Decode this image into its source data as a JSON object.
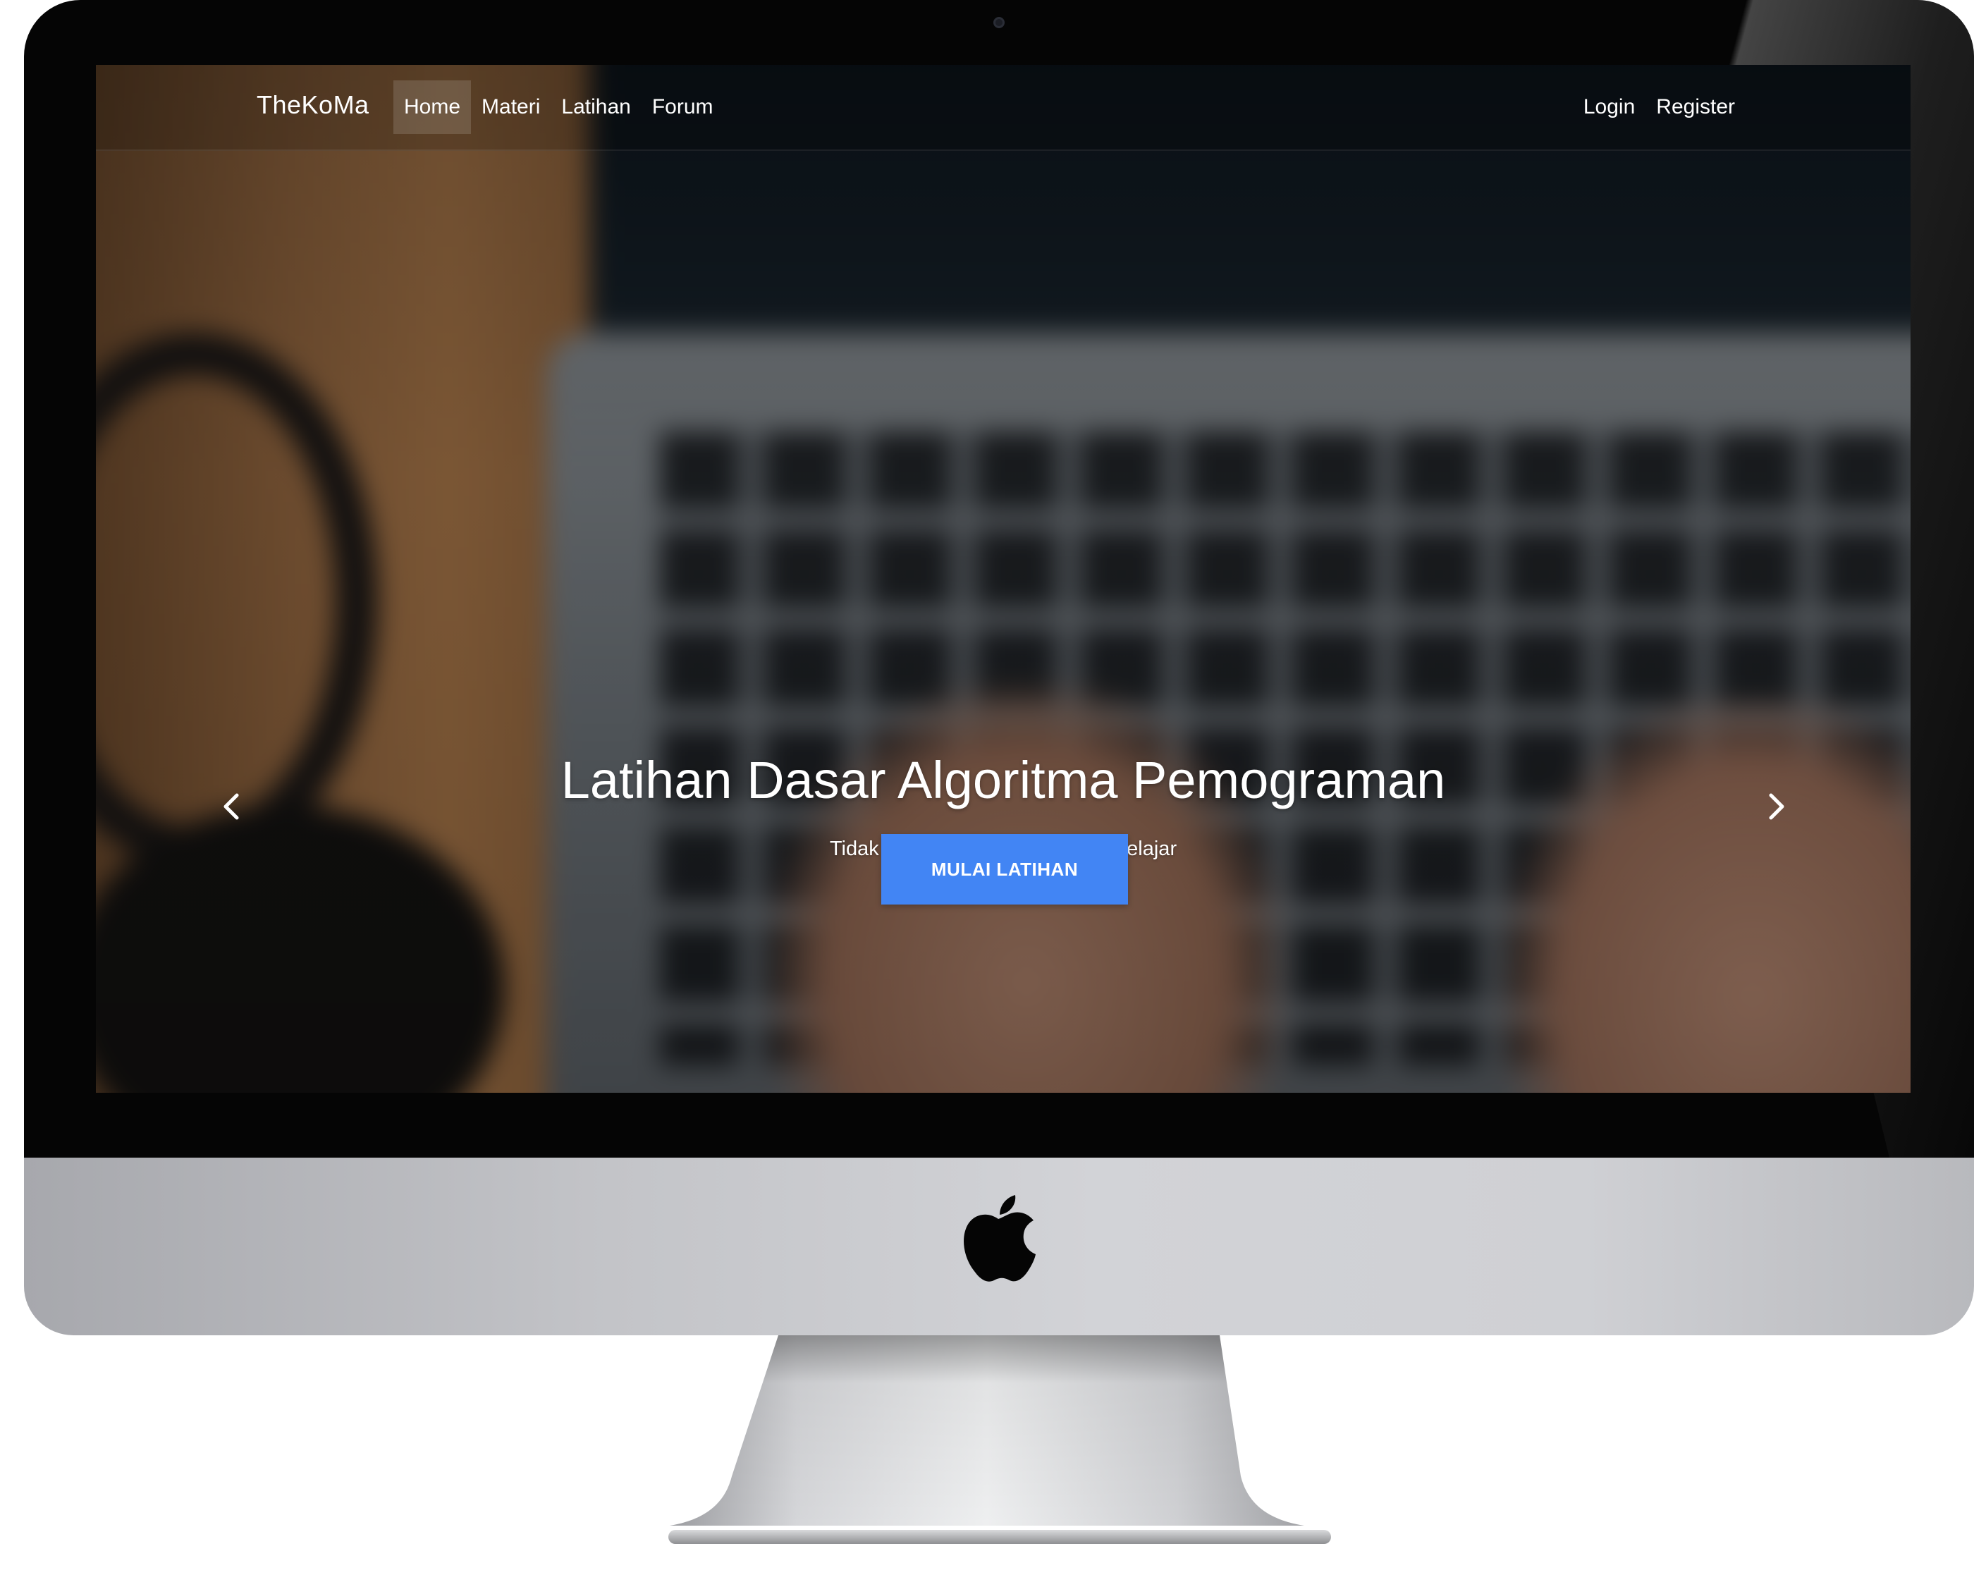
{
  "navbar": {
    "brand": "TheKoMa",
    "links": [
      {
        "label": "Home",
        "active": true
      },
      {
        "label": "Materi",
        "active": false
      },
      {
        "label": "Latihan",
        "active": false
      },
      {
        "label": "Forum",
        "active": false
      }
    ],
    "right_links": [
      {
        "label": "Login"
      },
      {
        "label": "Register"
      }
    ]
  },
  "hero": {
    "title": "Latihan Dasar Algoritma Pemograman",
    "subtitle": "Tidak ada kata terlambat untuk belajar",
    "cta_label": "MULAI LATIHAN",
    "prev_icon": "chevron-left-icon",
    "next_icon": "chevron-right-icon"
  },
  "colors": {
    "cta_background": "#4285f4",
    "bezel": "#050505",
    "chin": "#cfd0d4"
  },
  "device": {
    "logo_icon": "apple-logo-icon"
  }
}
